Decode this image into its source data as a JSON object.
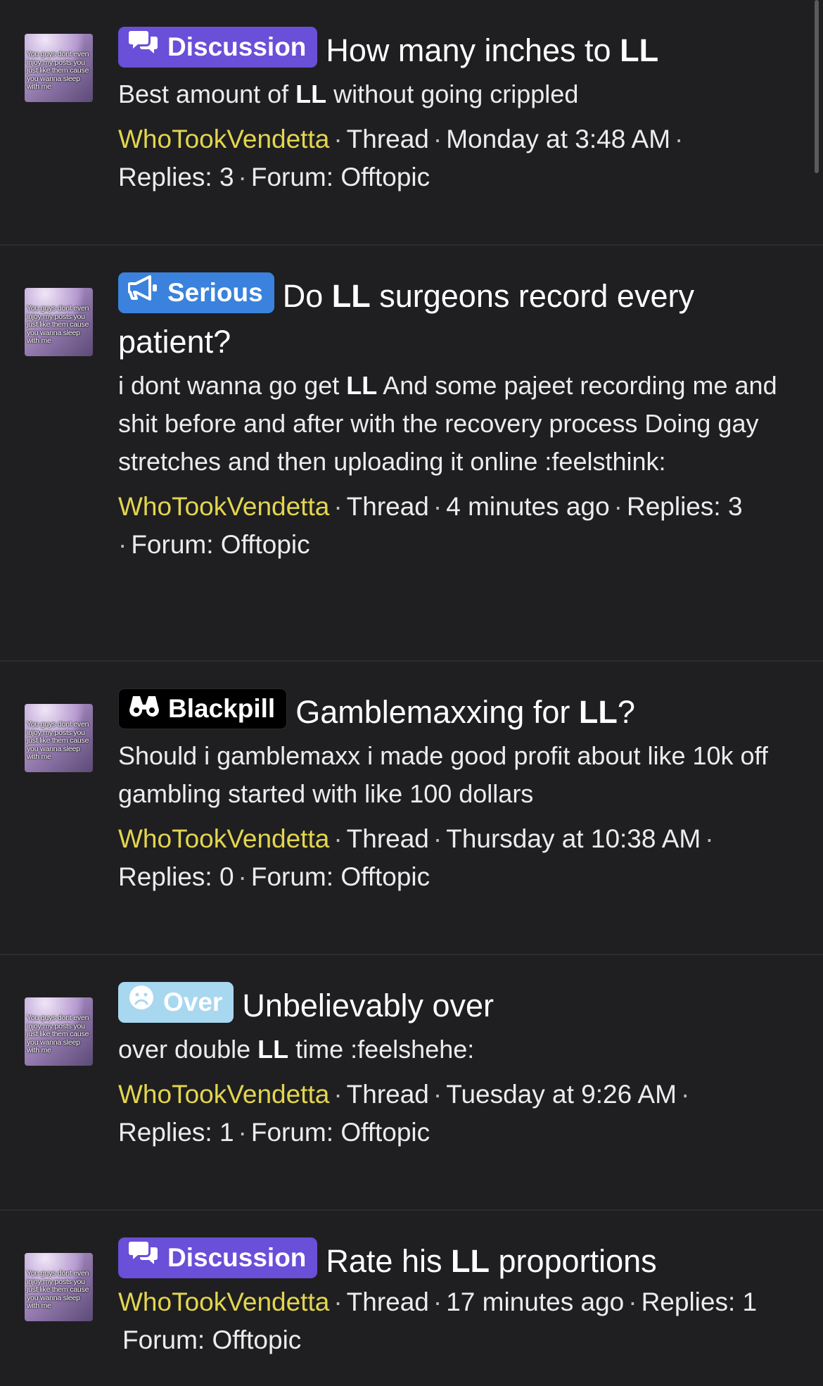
{
  "threads": [
    {
      "prefix": {
        "label": "Discussion",
        "icon": "chat-bubbles-icon",
        "color": "#6a4fd8"
      },
      "title_before": "How many inches to ",
      "title_bold": "LL",
      "title_after": "",
      "snippet_before": "Best amount of ",
      "snippet_bold": "LL",
      "snippet_after": " without going crippled",
      "author": "WhoTookVendetta",
      "type": "Thread",
      "time": "Monday at 3:48 AM",
      "replies": "Replies: 3",
      "forum": "Forum: Offtopic"
    },
    {
      "prefix": {
        "label": "Serious",
        "icon": "megaphone-icon",
        "color": "#3a82dd"
      },
      "title_before": "Do ",
      "title_bold": "LL",
      "title_after": " surgeons record every patient?",
      "snippet_before": "i dont wanna go get ",
      "snippet_bold": "LL",
      "snippet_after": " And some pajeet recording me and shit before and after with the recovery process Doing gay stretches and then uploading it online :feelsthink:",
      "author": "WhoTookVendetta",
      "type": "Thread",
      "time": "4 minutes ago",
      "replies": "Replies: 3",
      "forum": "Forum: Offtopic"
    },
    {
      "prefix": {
        "label": "Blackpill",
        "icon": "binoculars-icon",
        "color": "#000000"
      },
      "title_before": "Gamblemaxxing for ",
      "title_bold": "LL",
      "title_after": "?",
      "snippet_before": "Should i gamblemaxx i made good profit about like 10k off gambling started with like 100 dollars",
      "snippet_bold": "",
      "snippet_after": "",
      "author": "WhoTookVendetta",
      "type": "Thread",
      "time": "Thursday at 10:38 AM",
      "replies": "Replies: 0",
      "forum": "Forum: Offtopic"
    },
    {
      "prefix": {
        "label": "Over",
        "icon": "sad-face-icon",
        "color": "#a8d7f0"
      },
      "title_before": "Unbelievably over",
      "title_bold": "",
      "title_after": "",
      "snippet_before": "over double ",
      "snippet_bold": "LL",
      "snippet_after": " time :feelshehe:",
      "author": "WhoTookVendetta",
      "type": "Thread",
      "time": "Tuesday at 9:26 AM",
      "replies": "Replies: 1",
      "forum": "Forum: Offtopic"
    },
    {
      "prefix": {
        "label": "Discussion",
        "icon": "chat-bubbles-icon",
        "color": "#6a4fd8"
      },
      "title_before": "Rate his ",
      "title_bold": "LL",
      "title_after": " proportions",
      "snippet_before": "",
      "snippet_bold": "",
      "snippet_after": "",
      "author": "WhoTookVendetta",
      "type": "Thread",
      "time": "17 minutes ago",
      "replies": "Replies: 1",
      "forum": "Forum: Offtopic"
    }
  ],
  "avatar_text": "You guys dont even injoy my posts you just like them cause you wanna sleep with me"
}
